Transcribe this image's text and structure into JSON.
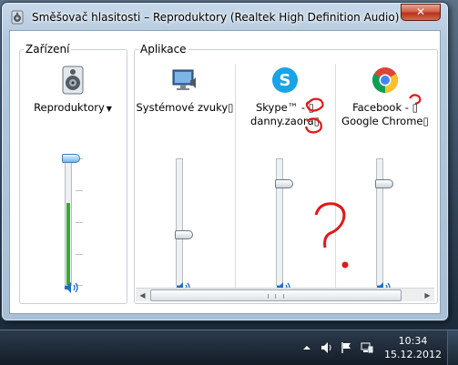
{
  "window": {
    "title": "Směšovač hlasitosti – Reproduktory (Realtek High Definition Audio)",
    "close_label": "✕"
  },
  "device_group": {
    "label": "Zařízení",
    "device": {
      "name": "Reproduktory",
      "icon": "speaker-device-icon",
      "volume_level": 1.0,
      "meter_level": 0.65
    }
  },
  "apps_group": {
    "label": "Aplikace",
    "apps": [
      {
        "name": "Systémové zvuky▯",
        "icon": "system-sounds-icon",
        "volume_level": 0.4
      },
      {
        "name": "Skype™ - ▯",
        "name2": "danny.zaora▯",
        "icon": "skype-icon",
        "volume_level": 0.8
      },
      {
        "name": "Facebook - ▯",
        "name2": "Google Chrome▯",
        "icon": "chrome-icon",
        "volume_level": 0.8
      }
    ]
  },
  "taskbar": {
    "time": "10:34",
    "date": "15.12.2012",
    "tray_icons": [
      "tray-up-arrow-icon",
      "volume-tray-icon",
      "action-center-flag-icon",
      "network-icon"
    ]
  },
  "colors": {
    "meter_green": "#3aa838",
    "accent_blue": "#1e6fc4",
    "annotation_red": "#e01818"
  }
}
